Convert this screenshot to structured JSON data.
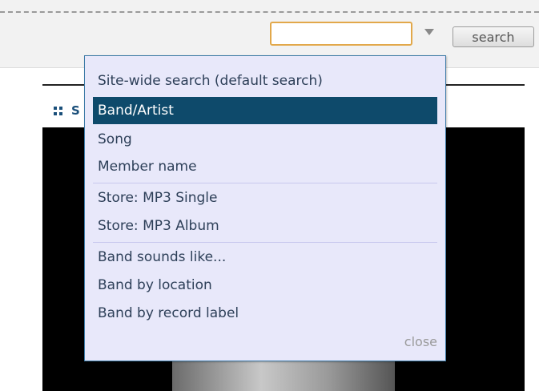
{
  "search": {
    "value": "",
    "button_label": "search"
  },
  "panel": {
    "title": "S"
  },
  "menu": {
    "items": [
      {
        "label": "Site-wide search (default search)",
        "selected": false
      },
      {
        "label": "Band/Artist",
        "selected": true
      },
      {
        "label": "Song",
        "selected": false
      },
      {
        "label": "Member name",
        "selected": false
      },
      {
        "label": "Store: MP3 Single",
        "selected": false
      },
      {
        "label": "Store: MP3 Album",
        "selected": false
      },
      {
        "label": "Band sounds like...",
        "selected": false
      },
      {
        "label": "Band by location",
        "selected": false
      },
      {
        "label": "Band by record label",
        "selected": false
      }
    ],
    "close_label": "close"
  },
  "colors": {
    "selection": "#0e4a6b",
    "menu_background": "#e8e8fa",
    "input_border": "#e2a84a",
    "menu_text": "#2d3f58"
  }
}
